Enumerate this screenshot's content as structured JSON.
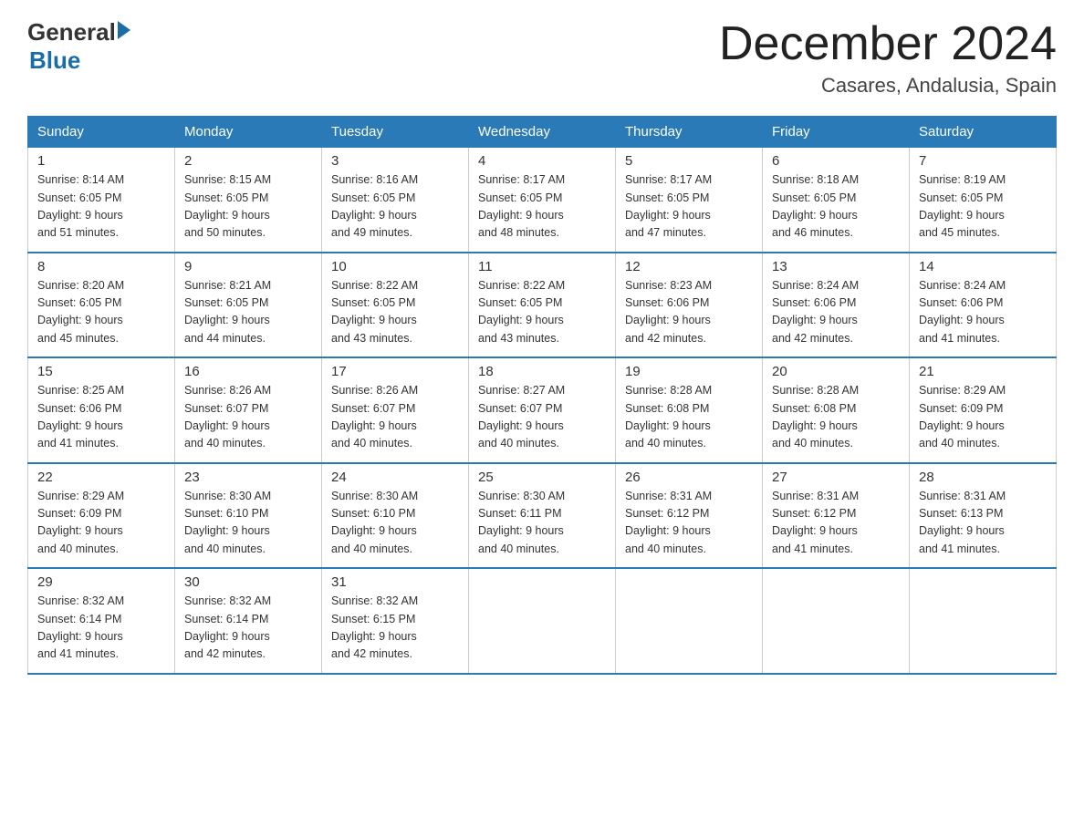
{
  "header": {
    "logo_general": "General",
    "logo_blue": "Blue",
    "month_title": "December 2024",
    "location": "Casares, Andalusia, Spain"
  },
  "weekdays": [
    "Sunday",
    "Monday",
    "Tuesday",
    "Wednesday",
    "Thursday",
    "Friday",
    "Saturday"
  ],
  "weeks": [
    [
      {
        "day": "1",
        "sunrise": "8:14 AM",
        "sunset": "6:05 PM",
        "daylight": "9 hours and 51 minutes."
      },
      {
        "day": "2",
        "sunrise": "8:15 AM",
        "sunset": "6:05 PM",
        "daylight": "9 hours and 50 minutes."
      },
      {
        "day": "3",
        "sunrise": "8:16 AM",
        "sunset": "6:05 PM",
        "daylight": "9 hours and 49 minutes."
      },
      {
        "day": "4",
        "sunrise": "8:17 AM",
        "sunset": "6:05 PM",
        "daylight": "9 hours and 48 minutes."
      },
      {
        "day": "5",
        "sunrise": "8:17 AM",
        "sunset": "6:05 PM",
        "daylight": "9 hours and 47 minutes."
      },
      {
        "day": "6",
        "sunrise": "8:18 AM",
        "sunset": "6:05 PM",
        "daylight": "9 hours and 46 minutes."
      },
      {
        "day": "7",
        "sunrise": "8:19 AM",
        "sunset": "6:05 PM",
        "daylight": "9 hours and 45 minutes."
      }
    ],
    [
      {
        "day": "8",
        "sunrise": "8:20 AM",
        "sunset": "6:05 PM",
        "daylight": "9 hours and 45 minutes."
      },
      {
        "day": "9",
        "sunrise": "8:21 AM",
        "sunset": "6:05 PM",
        "daylight": "9 hours and 44 minutes."
      },
      {
        "day": "10",
        "sunrise": "8:22 AM",
        "sunset": "6:05 PM",
        "daylight": "9 hours and 43 minutes."
      },
      {
        "day": "11",
        "sunrise": "8:22 AM",
        "sunset": "6:05 PM",
        "daylight": "9 hours and 43 minutes."
      },
      {
        "day": "12",
        "sunrise": "8:23 AM",
        "sunset": "6:06 PM",
        "daylight": "9 hours and 42 minutes."
      },
      {
        "day": "13",
        "sunrise": "8:24 AM",
        "sunset": "6:06 PM",
        "daylight": "9 hours and 42 minutes."
      },
      {
        "day": "14",
        "sunrise": "8:24 AM",
        "sunset": "6:06 PM",
        "daylight": "9 hours and 41 minutes."
      }
    ],
    [
      {
        "day": "15",
        "sunrise": "8:25 AM",
        "sunset": "6:06 PM",
        "daylight": "9 hours and 41 minutes."
      },
      {
        "day": "16",
        "sunrise": "8:26 AM",
        "sunset": "6:07 PM",
        "daylight": "9 hours and 40 minutes."
      },
      {
        "day": "17",
        "sunrise": "8:26 AM",
        "sunset": "6:07 PM",
        "daylight": "9 hours and 40 minutes."
      },
      {
        "day": "18",
        "sunrise": "8:27 AM",
        "sunset": "6:07 PM",
        "daylight": "9 hours and 40 minutes."
      },
      {
        "day": "19",
        "sunrise": "8:28 AM",
        "sunset": "6:08 PM",
        "daylight": "9 hours and 40 minutes."
      },
      {
        "day": "20",
        "sunrise": "8:28 AM",
        "sunset": "6:08 PM",
        "daylight": "9 hours and 40 minutes."
      },
      {
        "day": "21",
        "sunrise": "8:29 AM",
        "sunset": "6:09 PM",
        "daylight": "9 hours and 40 minutes."
      }
    ],
    [
      {
        "day": "22",
        "sunrise": "8:29 AM",
        "sunset": "6:09 PM",
        "daylight": "9 hours and 40 minutes."
      },
      {
        "day": "23",
        "sunrise": "8:30 AM",
        "sunset": "6:10 PM",
        "daylight": "9 hours and 40 minutes."
      },
      {
        "day": "24",
        "sunrise": "8:30 AM",
        "sunset": "6:10 PM",
        "daylight": "9 hours and 40 minutes."
      },
      {
        "day": "25",
        "sunrise": "8:30 AM",
        "sunset": "6:11 PM",
        "daylight": "9 hours and 40 minutes."
      },
      {
        "day": "26",
        "sunrise": "8:31 AM",
        "sunset": "6:12 PM",
        "daylight": "9 hours and 40 minutes."
      },
      {
        "day": "27",
        "sunrise": "8:31 AM",
        "sunset": "6:12 PM",
        "daylight": "9 hours and 41 minutes."
      },
      {
        "day": "28",
        "sunrise": "8:31 AM",
        "sunset": "6:13 PM",
        "daylight": "9 hours and 41 minutes."
      }
    ],
    [
      {
        "day": "29",
        "sunrise": "8:32 AM",
        "sunset": "6:14 PM",
        "daylight": "9 hours and 41 minutes."
      },
      {
        "day": "30",
        "sunrise": "8:32 AM",
        "sunset": "6:14 PM",
        "daylight": "9 hours and 42 minutes."
      },
      {
        "day": "31",
        "sunrise": "8:32 AM",
        "sunset": "6:15 PM",
        "daylight": "9 hours and 42 minutes."
      },
      null,
      null,
      null,
      null
    ]
  ],
  "labels": {
    "sunrise_prefix": "Sunrise: ",
    "sunset_prefix": "Sunset: ",
    "daylight_prefix": "Daylight: "
  }
}
